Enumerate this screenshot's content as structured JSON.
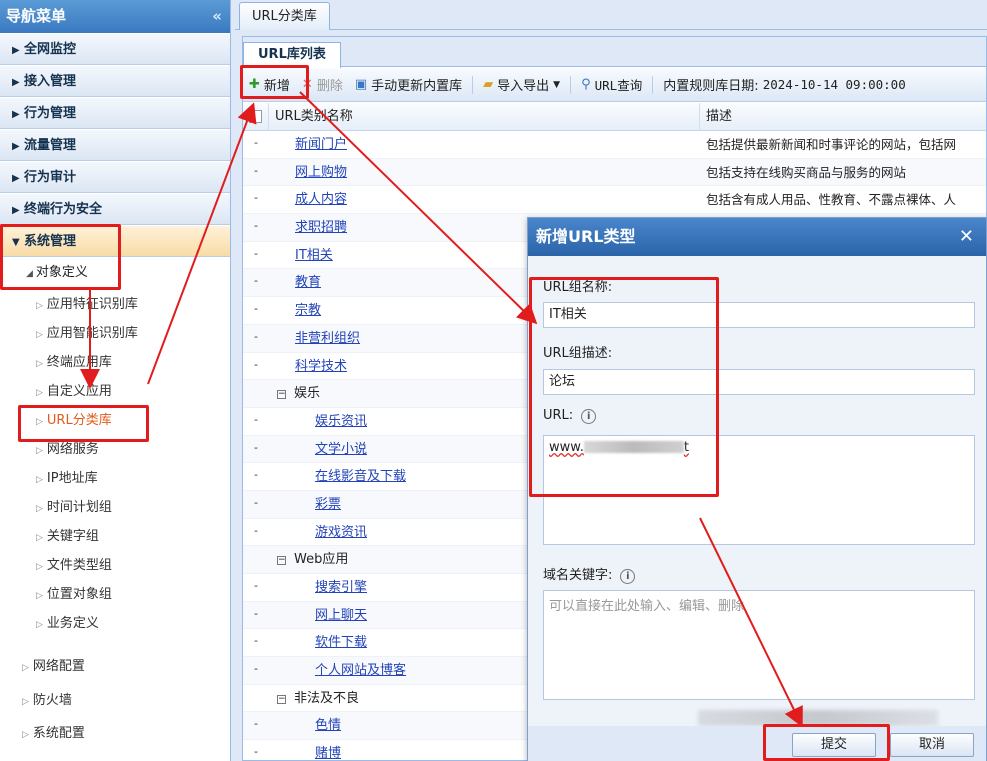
{
  "sidebar": {
    "title": "导航菜单",
    "collapse_icon": "double-chevron-left-icon",
    "accordions": [
      "全网监控",
      "接入管理",
      "行为管理",
      "流量管理",
      "行为审计",
      "终端行为安全"
    ],
    "open_accordion": "系统管理",
    "open_sub": "对象定义",
    "leaves": [
      "应用特征识别库",
      "应用智能识别库",
      "终端应用库",
      "自定义应用",
      "URL分类库",
      "网络服务",
      "IP地址库",
      "时间计划组",
      "关键字组",
      "文件类型组",
      "位置对象组",
      "业务定义"
    ],
    "selected_leaf": "URL分类库",
    "groups": [
      "网络配置",
      "防火墙",
      "系统配置"
    ]
  },
  "main": {
    "tab": "URL分类库",
    "subtab": "URL库列表",
    "toolbar": {
      "add": "新增",
      "delete": "删除",
      "update": "手动更新内置库",
      "import_export": "导入导出",
      "query": "URL查询",
      "date_label": "内置规则库日期:",
      "date_value": "2024-10-14 09:00:00"
    },
    "grid": {
      "col_name": "URL类别名称",
      "col_desc": "描述",
      "rows": [
        {
          "name": "新闻门户",
          "level": 1,
          "desc": "包括提供最新新闻和时事评论的网站，包括网"
        },
        {
          "name": "网上购物",
          "level": 1,
          "desc": "包括支持在线购买商品与服务的网站"
        },
        {
          "name": "成人内容",
          "level": 1,
          "desc": "包括含有成人用品、性教育、不露点裸体、人"
        },
        {
          "name": "求职招聘",
          "level": 1,
          "desc": ""
        },
        {
          "name": "IT相关",
          "level": 1,
          "desc": ""
        },
        {
          "name": "教育",
          "level": 1,
          "desc": ""
        },
        {
          "name": "宗教",
          "level": 1,
          "desc": ""
        },
        {
          "name": "非营利组织",
          "level": 1,
          "desc": ""
        },
        {
          "name": "科学技术",
          "level": 1,
          "desc": ""
        },
        {
          "name": "娱乐",
          "level": 0,
          "desc": ""
        },
        {
          "name": "娱乐资讯",
          "level": 2,
          "desc": ""
        },
        {
          "name": "文学小说",
          "level": 2,
          "desc": ""
        },
        {
          "name": "在线影音及下载",
          "level": 2,
          "desc": ""
        },
        {
          "name": "彩票",
          "level": 2,
          "desc": ""
        },
        {
          "name": "游戏资讯",
          "level": 2,
          "desc": ""
        },
        {
          "name": "Web应用",
          "level": 0,
          "desc": ""
        },
        {
          "name": "搜索引擎",
          "level": 2,
          "desc": ""
        },
        {
          "name": "网上聊天",
          "level": 2,
          "desc": ""
        },
        {
          "name": "软件下载",
          "level": 2,
          "desc": ""
        },
        {
          "name": "个人网站及博客",
          "level": 2,
          "desc": ""
        },
        {
          "name": "非法及不良",
          "level": 0,
          "desc": ""
        },
        {
          "name": "色情",
          "level": 2,
          "desc": ""
        },
        {
          "name": "赌博",
          "level": 2,
          "desc": ""
        }
      ]
    }
  },
  "dialog": {
    "title": "新增URL类型",
    "name_label": "URL组名称:",
    "name_value": "IT相关",
    "desc_label": "URL组描述:",
    "desc_value": "论坛",
    "url_label": "URL:",
    "url_value_prefix": "www.",
    "url_value_suffix": "t",
    "keyword_label": "域名关键字:",
    "keyword_placeholder": "可以直接在此处输入、编辑、删除",
    "submit": "提交",
    "cancel": "取消"
  },
  "colors": {
    "highlight": "#e21c1c",
    "header_blue": "#3a79c1",
    "link": "#2344b8"
  }
}
